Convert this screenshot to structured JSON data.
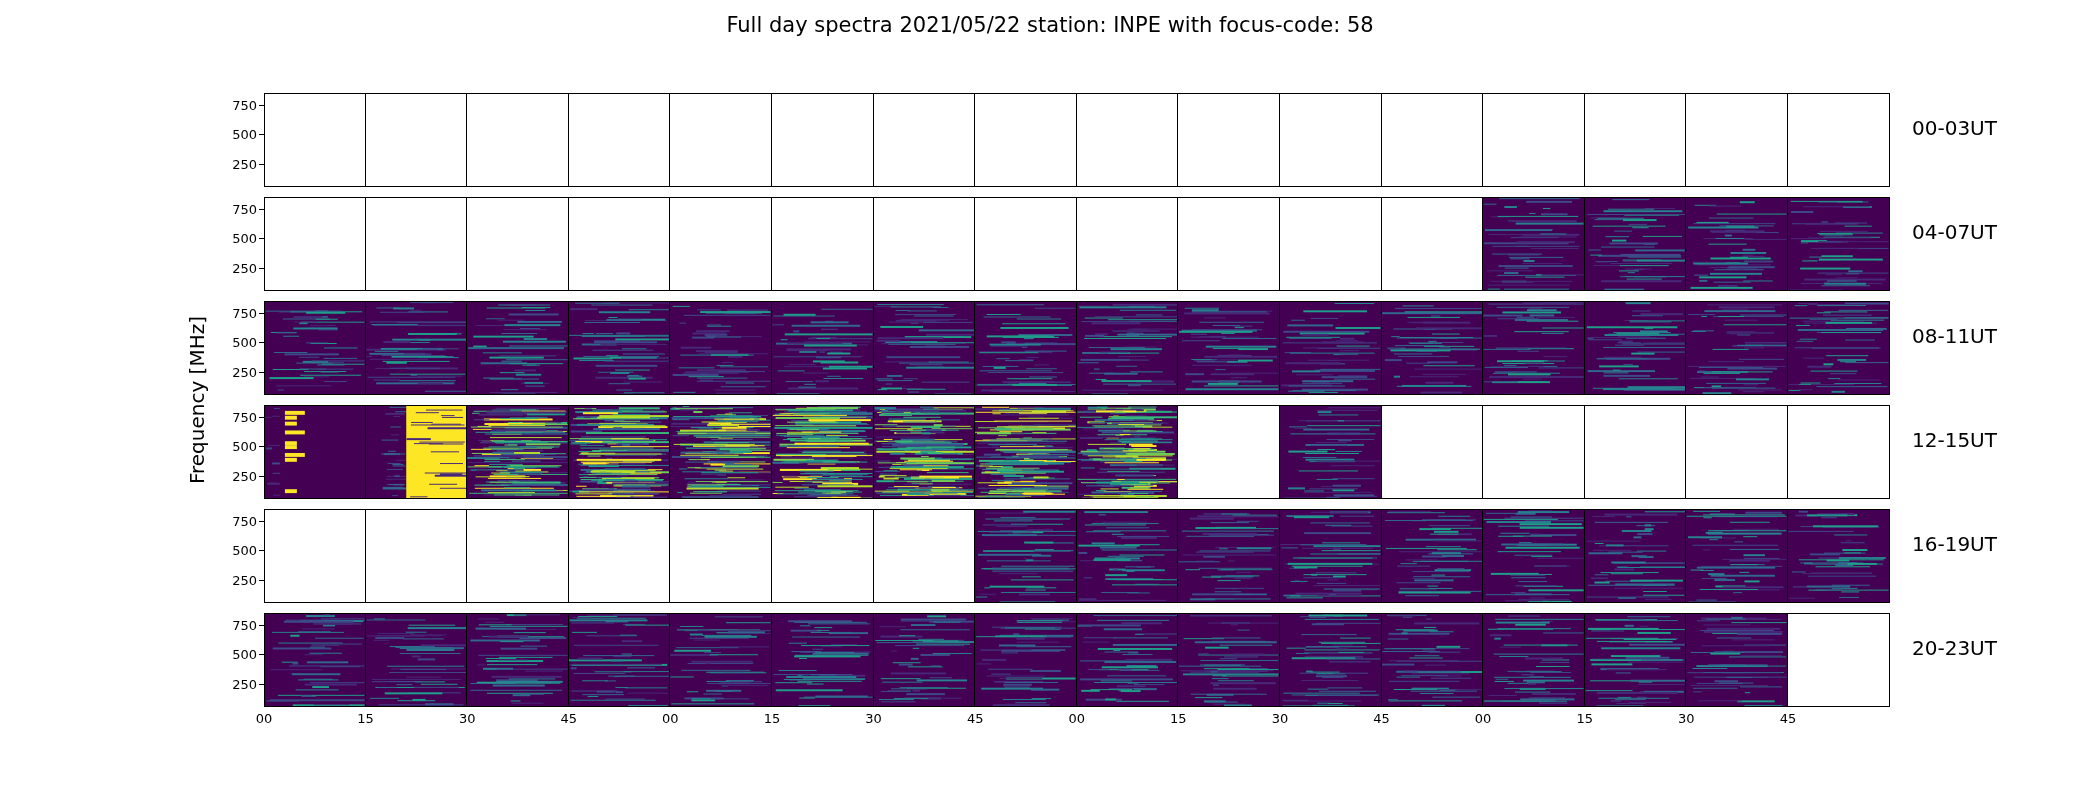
{
  "title": "Full day spectra 2021/05/22 station: INPE with focus-code: 58",
  "ylabel": "Frequency [MHz]",
  "x_ticks": [
    "00",
    "15",
    "30",
    "45",
    "00",
    "15",
    "30",
    "45",
    "00",
    "15",
    "30",
    "45",
    "00",
    "15",
    "30",
    "45"
  ],
  "rows": [
    {
      "label": "00-03UT",
      "y_ticks": [
        "750",
        "500",
        "250"
      ],
      "panels": [
        {
          "kind": "empty"
        },
        {
          "kind": "empty"
        },
        {
          "kind": "empty"
        },
        {
          "kind": "empty"
        },
        {
          "kind": "empty"
        },
        {
          "kind": "empty"
        },
        {
          "kind": "empty"
        },
        {
          "kind": "empty"
        },
        {
          "kind": "empty"
        },
        {
          "kind": "empty"
        },
        {
          "kind": "empty"
        },
        {
          "kind": "empty"
        },
        {
          "kind": "empty"
        },
        {
          "kind": "empty"
        },
        {
          "kind": "empty"
        },
        {
          "kind": "empty"
        }
      ]
    },
    {
      "label": "04-07UT",
      "y_ticks": [
        "750",
        "500",
        "250"
      ],
      "panels": [
        {
          "kind": "empty"
        },
        {
          "kind": "empty"
        },
        {
          "kind": "empty"
        },
        {
          "kind": "empty"
        },
        {
          "kind": "empty"
        },
        {
          "kind": "empty"
        },
        {
          "kind": "empty"
        },
        {
          "kind": "empty"
        },
        {
          "kind": "empty"
        },
        {
          "kind": "empty"
        },
        {
          "kind": "empty"
        },
        {
          "kind": "empty"
        },
        {
          "kind": "quiet"
        },
        {
          "kind": "quiet"
        },
        {
          "kind": "quiet"
        },
        {
          "kind": "quiet"
        }
      ]
    },
    {
      "label": "08-11UT",
      "y_ticks": [
        "750",
        "500",
        "250"
      ],
      "panels": [
        {
          "kind": "quiet"
        },
        {
          "kind": "quiet"
        },
        {
          "kind": "quiet"
        },
        {
          "kind": "quiet"
        },
        {
          "kind": "quiet"
        },
        {
          "kind": "quiet"
        },
        {
          "kind": "quiet"
        },
        {
          "kind": "quiet"
        },
        {
          "kind": "quiet"
        },
        {
          "kind": "quiet"
        },
        {
          "kind": "quiet"
        },
        {
          "kind": "quiet"
        },
        {
          "kind": "quiet"
        },
        {
          "kind": "quiet"
        },
        {
          "kind": "quiet"
        },
        {
          "kind": "quiet"
        }
      ]
    },
    {
      "label": "12-15UT",
      "y_ticks": [
        "750",
        "500",
        "250"
      ],
      "panels": [
        {
          "kind": "flare-bars"
        },
        {
          "kind": "flare-onset"
        },
        {
          "kind": "saturated"
        },
        {
          "kind": "saturated"
        },
        {
          "kind": "saturated"
        },
        {
          "kind": "saturated"
        },
        {
          "kind": "saturated"
        },
        {
          "kind": "saturated"
        },
        {
          "kind": "saturated"
        },
        {
          "kind": "empty"
        },
        {
          "kind": "quiet"
        },
        {
          "kind": "empty"
        },
        {
          "kind": "empty"
        },
        {
          "kind": "empty"
        },
        {
          "kind": "empty"
        },
        {
          "kind": "empty"
        }
      ]
    },
    {
      "label": "16-19UT",
      "y_ticks": [
        "750",
        "500",
        "250"
      ],
      "panels": [
        {
          "kind": "empty"
        },
        {
          "kind": "empty"
        },
        {
          "kind": "empty"
        },
        {
          "kind": "empty"
        },
        {
          "kind": "empty"
        },
        {
          "kind": "empty"
        },
        {
          "kind": "empty"
        },
        {
          "kind": "quiet"
        },
        {
          "kind": "quiet"
        },
        {
          "kind": "quiet"
        },
        {
          "kind": "quiet"
        },
        {
          "kind": "quiet"
        },
        {
          "kind": "quiet"
        },
        {
          "kind": "quiet"
        },
        {
          "kind": "quiet"
        },
        {
          "kind": "quiet"
        }
      ]
    },
    {
      "label": "20-23UT",
      "y_ticks": [
        "750",
        "500",
        "250"
      ],
      "panels": [
        {
          "kind": "quiet"
        },
        {
          "kind": "quiet"
        },
        {
          "kind": "quiet"
        },
        {
          "kind": "quiet"
        },
        {
          "kind": "quiet"
        },
        {
          "kind": "quiet"
        },
        {
          "kind": "quiet"
        },
        {
          "kind": "quiet"
        },
        {
          "kind": "quiet"
        },
        {
          "kind": "quiet"
        },
        {
          "kind": "quiet"
        },
        {
          "kind": "quiet"
        },
        {
          "kind": "quiet"
        },
        {
          "kind": "quiet"
        },
        {
          "kind": "quiet"
        },
        {
          "kind": "empty"
        }
      ]
    }
  ]
}
